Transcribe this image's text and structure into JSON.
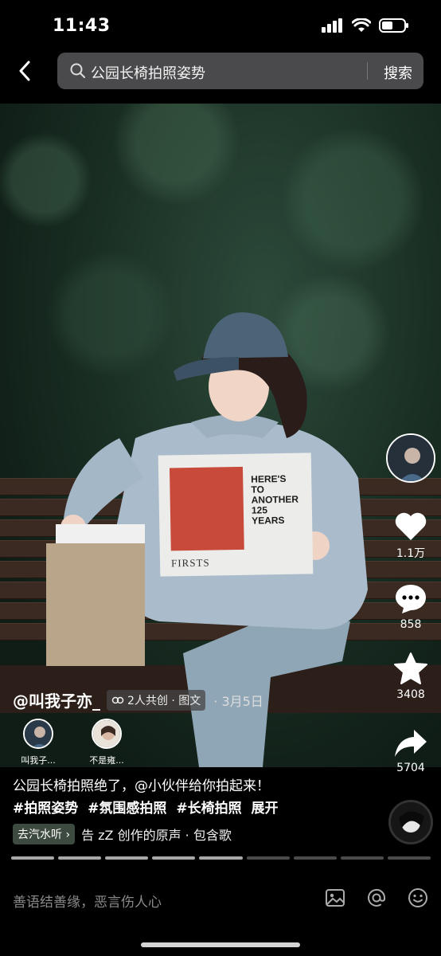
{
  "status_bar": {
    "time": "11:43",
    "icons": [
      "signal-icon",
      "wifi-icon",
      "battery-icon"
    ]
  },
  "search": {
    "query": "公园长椅拍照姿势",
    "button_label": "搜索"
  },
  "photo": {
    "poster_text": "HERE'S\nTO\nANOTHER\n125\nYEARS",
    "newspaper_masthead": "FIRSTS"
  },
  "rail": {
    "like_count": "1.1万",
    "comment_count": "858",
    "favorite_count": "3408",
    "share_count": "5704"
  },
  "post": {
    "author": "@叫我子亦_",
    "cocreate_label": "2人共创 · 图文",
    "date": "· 3月5日",
    "creators": [
      {
        "name": "叫我子..."
      },
      {
        "name": "不是雍..."
      }
    ],
    "description": "公园长椅拍照绝了，@小伙伴给你拍起来！",
    "tags": [
      "#拍照姿势",
      "#氛围感拍照",
      "#长椅拍照"
    ],
    "expand_label": "展开",
    "music_chip": "去汽水听 ›",
    "music_text": "告 zZ 创作的原声 · 包含歌"
  },
  "progress": {
    "total_segments": 9,
    "completed_segments": 5
  },
  "comment": {
    "placeholder": "善语结善缘，恶言伤人心",
    "icons": [
      "image-icon",
      "at-icon",
      "emoji-icon"
    ]
  },
  "colors": {
    "background": "#000000",
    "search_box": "#4a4a4c",
    "music_chip": "#3c4a3f"
  }
}
